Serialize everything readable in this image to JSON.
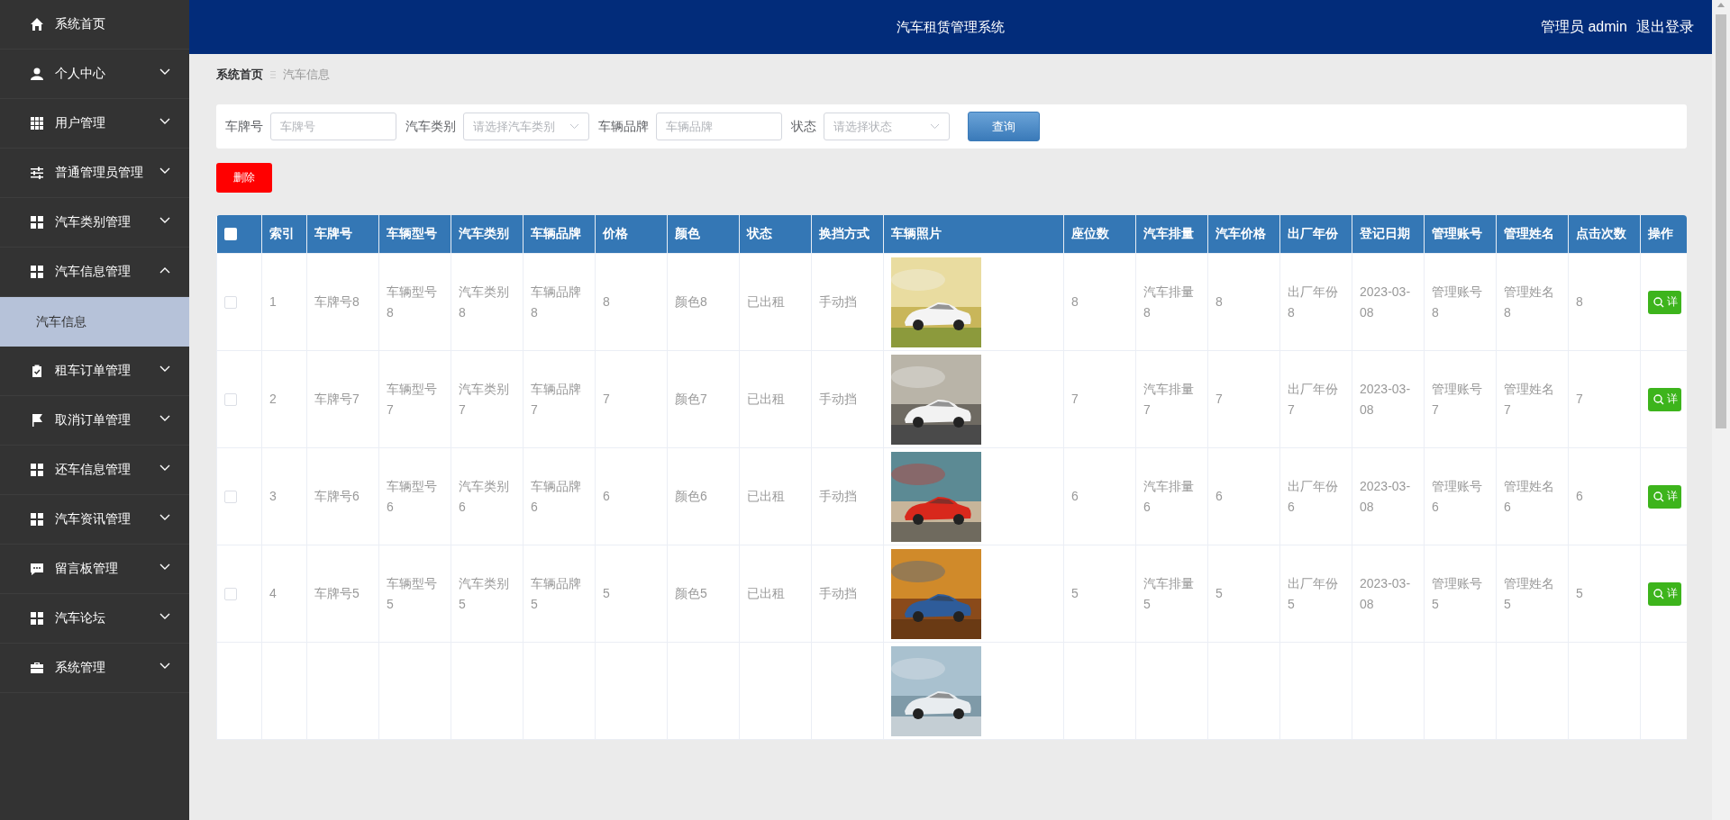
{
  "sidebar": {
    "items": [
      {
        "label": "系统首页",
        "kind": "link"
      },
      {
        "label": "个人中心",
        "kind": "menu",
        "expanded": false
      },
      {
        "label": "用户管理",
        "kind": "menu",
        "expanded": false
      },
      {
        "label": "普通管理员管理",
        "kind": "menu",
        "expanded": false
      },
      {
        "label": "汽车类别管理",
        "kind": "menu",
        "expanded": false
      },
      {
        "label": "汽车信息管理",
        "kind": "menu",
        "expanded": true,
        "children": [
          {
            "label": "汽车信息",
            "selected": true
          }
        ]
      },
      {
        "label": "租车订单管理",
        "kind": "menu",
        "expanded": false
      },
      {
        "label": "取消订单管理",
        "kind": "menu",
        "expanded": false
      },
      {
        "label": "还车信息管理",
        "kind": "menu",
        "expanded": false
      },
      {
        "label": "汽车资讯管理",
        "kind": "menu",
        "expanded": false
      },
      {
        "label": "留言板管理",
        "kind": "menu",
        "expanded": false
      },
      {
        "label": "汽车论坛",
        "kind": "menu",
        "expanded": false
      },
      {
        "label": "系统管理",
        "kind": "menu",
        "expanded": false
      }
    ]
  },
  "header": {
    "title": "汽车租赁管理系统",
    "user": "管理员 admin",
    "logout": "退出登录"
  },
  "breadcrumb": [
    "系统首页",
    "汽车信息"
  ],
  "search": {
    "fields": [
      {
        "label": "车牌号",
        "kind": "input",
        "placeholder": "车牌号"
      },
      {
        "label": "汽车类别",
        "kind": "select",
        "placeholder": "请选择汽车类别"
      },
      {
        "label": "车辆品牌",
        "kind": "input",
        "placeholder": "车辆品牌"
      },
      {
        "label": "状态",
        "kind": "select",
        "placeholder": "请选择状态"
      }
    ],
    "button": "查询"
  },
  "delete_button": "删除",
  "table": {
    "select_all": {
      "checked": false
    },
    "columns": [
      "索引",
      "车牌号",
      "车辆型号",
      "汽车类别",
      "车辆品牌",
      "价格",
      "颜色",
      "状态",
      "换挡方式",
      "车辆照片",
      "座位数",
      "汽车排量",
      "汽车价格",
      "出厂年份",
      "登记日期",
      "管理账号",
      "管理姓名",
      "点击次数",
      "操作"
    ],
    "rows": [
      {
        "checked": false,
        "cells": [
          "1",
          "车牌号8",
          "车辆型号8",
          "汽车类别8",
          "车辆品牌8",
          "8",
          "颜色8",
          "已出租",
          "手动挡"
        ],
        "photo": {
          "kind": "picture"
        },
        "cells_after": [
          "8",
          "汽车排量8",
          "8",
          "出厂年份8",
          "2023-03-08",
          "管理账号8",
          "管理姓名8",
          "8"
        ],
        "action": "详"
      },
      {
        "checked": false,
        "cells": [
          "2",
          "车牌号7",
          "车辆型号7",
          "汽车类别7",
          "车辆品牌7",
          "7",
          "颜色7",
          "已出租",
          "手动挡"
        ],
        "photo": {
          "kind": "picture"
        },
        "cells_after": [
          "7",
          "汽车排量7",
          "7",
          "出厂年份7",
          "2023-03-08",
          "管理账号7",
          "管理姓名7",
          "7"
        ],
        "action": "详"
      },
      {
        "checked": false,
        "cells": [
          "3",
          "车牌号6",
          "车辆型号6",
          "汽车类别6",
          "车辆品牌6",
          "6",
          "颜色6",
          "已出租",
          "手动挡"
        ],
        "photo": {
          "kind": "picture"
        },
        "cells_after": [
          "6",
          "汽车排量6",
          "6",
          "出厂年份6",
          "2023-03-08",
          "管理账号6",
          "管理姓名6",
          "6"
        ],
        "action": "详"
      },
      {
        "checked": false,
        "cells": [
          "4",
          "车牌号5",
          "车辆型号5",
          "汽车类别5",
          "车辆品牌5",
          "5",
          "颜色5",
          "已出租",
          "手动挡"
        ],
        "photo": {
          "kind": "picture"
        },
        "cells_after": [
          "5",
          "汽车排量5",
          "5",
          "出厂年份5",
          "2023-03-08",
          "管理账号5",
          "管理姓名5",
          "5"
        ],
        "action": "详"
      },
      {
        "photo": {
          "kind": "picture"
        }
      }
    ]
  }
}
